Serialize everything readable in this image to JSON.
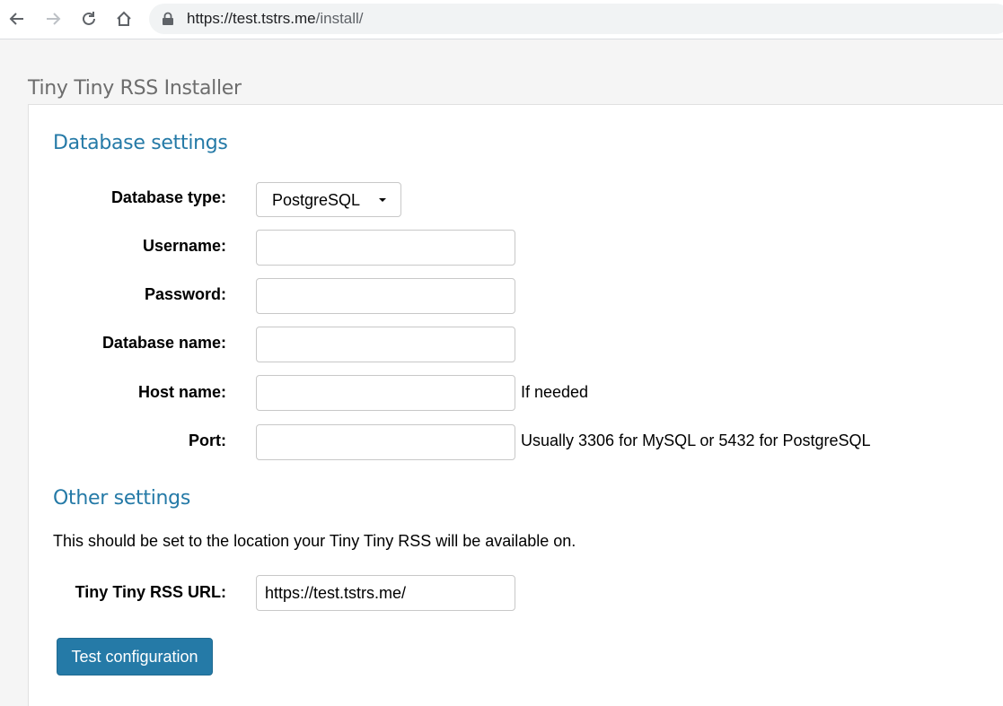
{
  "browser": {
    "url_host": "https://test.tstrs.me",
    "url_path": "/install/"
  },
  "page": {
    "title": "Tiny Tiny RSS Installer"
  },
  "database_settings": {
    "heading": "Database settings",
    "db_type": {
      "label": "Database type:",
      "value": "PostgreSQL"
    },
    "username": {
      "label": "Username:",
      "value": ""
    },
    "password": {
      "label": "Password:",
      "value": ""
    },
    "db_name": {
      "label": "Database name:",
      "value": ""
    },
    "host": {
      "label": "Host name:",
      "value": "",
      "hint": "If needed"
    },
    "port": {
      "label": "Port:",
      "value": "",
      "hint": "Usually 3306 for MySQL or 5432 for PostgreSQL"
    }
  },
  "other_settings": {
    "heading": "Other settings",
    "description": "This should be set to the location your Tiny Tiny RSS will be available on.",
    "url": {
      "label": "Tiny Tiny RSS URL:",
      "value": "https://test.tstrs.me/"
    }
  },
  "actions": {
    "test_label": "Test configuration"
  },
  "colors": {
    "accent": "#257aa7"
  }
}
